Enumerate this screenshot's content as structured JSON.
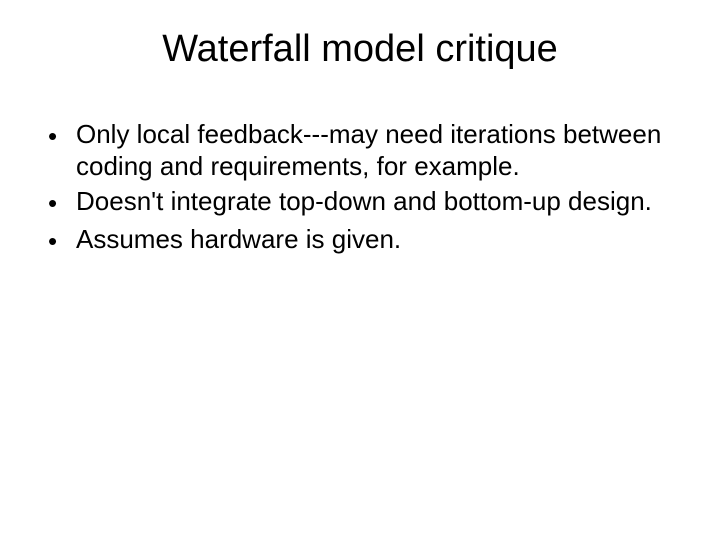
{
  "slide": {
    "title": "Waterfall model critique",
    "bullets": [
      "Only local feedback---may need iterations between coding and requirements, for example.",
      "Doesn't integrate top-down and bottom-up design.",
      "Assumes hardware is given."
    ]
  }
}
